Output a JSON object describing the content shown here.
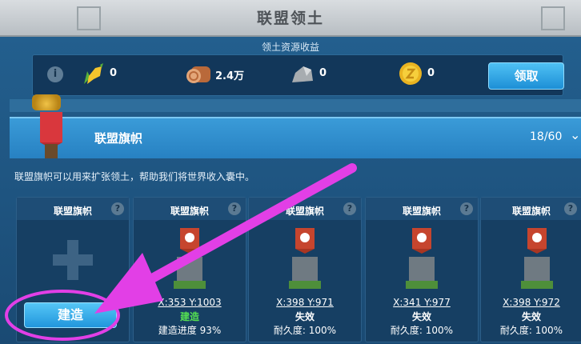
{
  "window": {
    "title": "联盟领土"
  },
  "resources": {
    "title": "领土资源收益",
    "info_icon": "i",
    "items": [
      {
        "icon": "corn-icon",
        "value": "0"
      },
      {
        "icon": "wood-log-icon",
        "value": "2.4万"
      },
      {
        "icon": "stone-icon",
        "value": "0"
      },
      {
        "icon": "gold-coin-icon",
        "value": "0"
      }
    ],
    "claim_label": "领取"
  },
  "section": {
    "title": "联盟旗帜",
    "count": "18/60",
    "chevron": "⌄"
  },
  "description": "联盟旗帜可以用来扩张领土，帮助我们将世界收入囊中。",
  "cards": [
    {
      "name": "联盟旗帜",
      "q": "?",
      "build_label": "建造"
    },
    {
      "name": "联盟旗帜",
      "q": "?",
      "coord": "X:353 Y:1003",
      "status": "建造",
      "detail": "建造进度 93%"
    },
    {
      "name": "联盟旗帜",
      "q": "?",
      "coord": "X:398 Y:971",
      "status": "失效",
      "detail": "耐久度: 100%"
    },
    {
      "name": "联盟旗帜",
      "q": "?",
      "coord": "X:341 Y:977",
      "status": "失效",
      "detail": "耐久度: 100%"
    },
    {
      "name": "联盟旗帜",
      "q": "?",
      "coord": "X:398 Y:972",
      "status": "失效",
      "detail": "耐久度: 100%"
    }
  ],
  "colors": {
    "accent": "#2d9be0",
    "annotation": "#e23fe6",
    "status_green": "#55e052"
  }
}
